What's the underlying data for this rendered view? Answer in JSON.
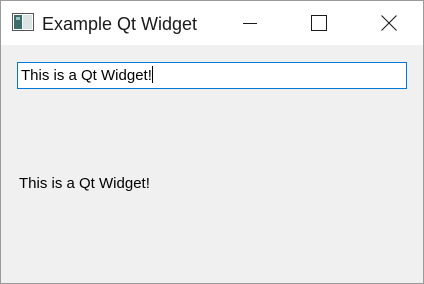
{
  "window": {
    "title": "Example Qt Widget",
    "icon": "qt-window-icon",
    "controls": {
      "minimize_icon": "minimize-icon",
      "maximize_icon": "maximize-icon",
      "close_icon": "close-icon"
    }
  },
  "line_edit": {
    "value": "This is a Qt Widget!"
  },
  "label": {
    "text": "This is a Qt Widget!"
  },
  "colors": {
    "focus_border": "#0078d7",
    "window_background": "#f0f0f0",
    "titlebar_background": "#ffffff"
  }
}
